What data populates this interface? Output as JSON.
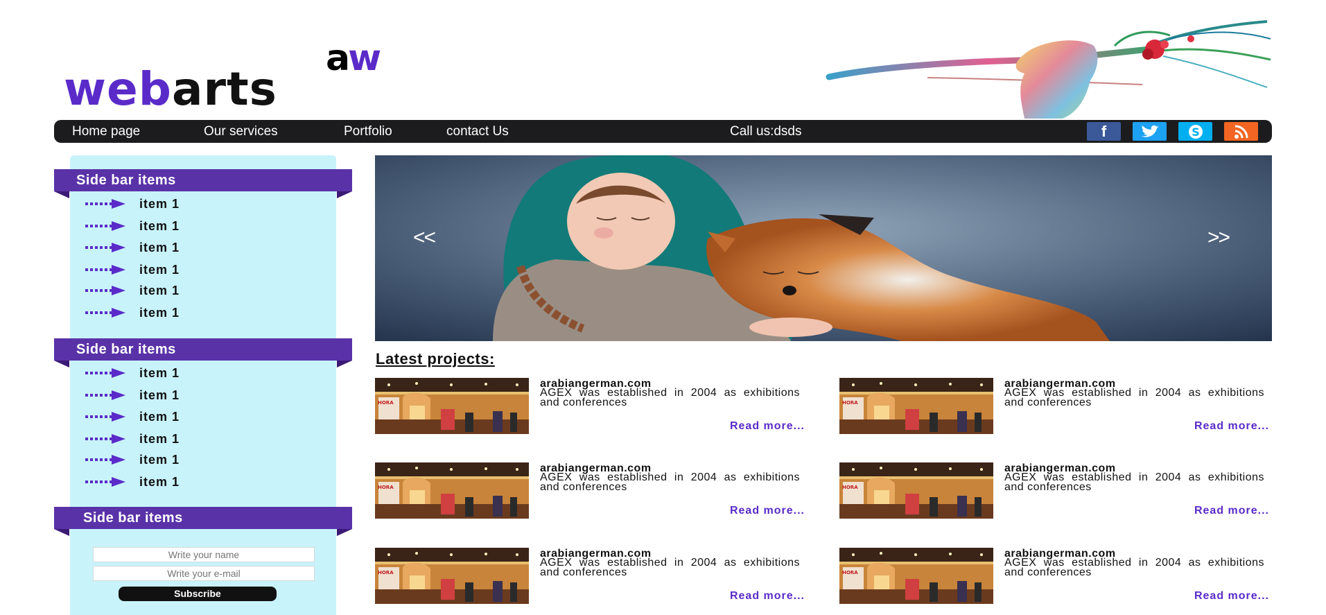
{
  "logo": {
    "aw_a": "a",
    "aw_w": "w",
    "web": "web",
    "arts": "arts"
  },
  "nav": {
    "items": [
      "Home page",
      "Our services",
      "Portfolio",
      "contact Us"
    ],
    "call": "Call us:dsds",
    "social": [
      {
        "name": "facebook-icon",
        "glyph": "f",
        "color": "#3b5998"
      },
      {
        "name": "twitter-icon",
        "glyph": "t",
        "color": "#1da1f2"
      },
      {
        "name": "skype-icon",
        "glyph": "S",
        "color": "#00aff0"
      },
      {
        "name": "rss-icon",
        "glyph": ")",
        "color": "#f26522"
      }
    ]
  },
  "sidebar": {
    "blocks": [
      {
        "title": "Side bar items",
        "items": [
          "item 1",
          "item 1",
          "item 1",
          "item 1",
          "item 1",
          "item 1"
        ]
      },
      {
        "title": "Side bar items",
        "items": [
          "item 1",
          "item 1",
          "item 1",
          "item 1",
          "item 1",
          "item 1"
        ]
      },
      {
        "title": "Side bar items"
      }
    ],
    "form": {
      "name_placeholder": "Write your name",
      "email_placeholder": "Write your e-mail",
      "subscribe_label": "Subscribe"
    }
  },
  "slider": {
    "prev": "<<",
    "next": ">>"
  },
  "latest": {
    "title": "Latest projects:",
    "projects": [
      {
        "site": "arabiangerman.com",
        "desc": "AGEX was established in 2004 as exhibitions and conferences",
        "more": "Read more..."
      },
      {
        "site": "arabiangerman.com",
        "desc": "AGEX was established in 2004 as exhibitions and conferences",
        "more": "Read more..."
      },
      {
        "site": "arabiangerman.com",
        "desc": "AGEX was established in 2004 as exhibitions and conferences",
        "more": "Read more..."
      },
      {
        "site": "arabiangerman.com",
        "desc": "AGEX was established in 2004 as exhibitions and conferences",
        "more": "Read more..."
      },
      {
        "site": "arabiangerman.com",
        "desc": "AGEX was established in 2004 as exhibitions and conferences",
        "more": "Read more..."
      },
      {
        "site": "arabiangerman.com",
        "desc": "AGEX was established in 2004 as exhibitions and conferences",
        "more": "Read more..."
      }
    ]
  },
  "colors": {
    "accent": "#5a2bc9",
    "sidebar_bg": "#c8f3fb",
    "nav_bg": "#1c1c1e",
    "header_purple": "#5a32a8"
  }
}
